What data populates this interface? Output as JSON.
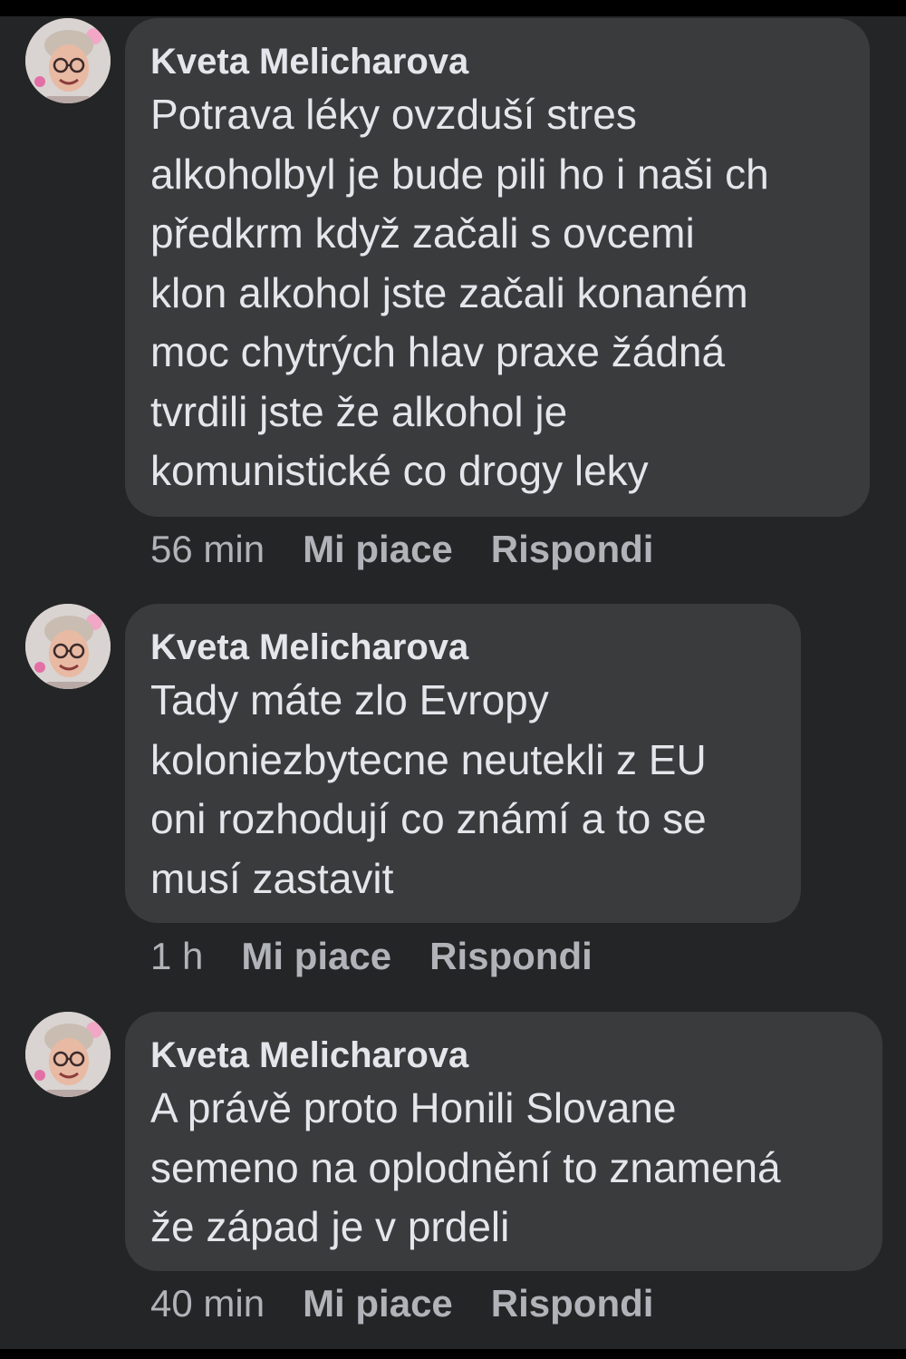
{
  "comments": [
    {
      "author": "Kveta Melicharova",
      "lines": [
        "Potrava léky ovzduší stres",
        "alkoholbyl je bude pili ho i naši ch",
        "předkrm když začali s ovcemi",
        "klon alkohol jste začali konaném",
        "moc chytrých hlav praxe žádná",
        "tvrdili jste že alkohol je",
        "komunistické co drogy leky"
      ],
      "time": "56 min",
      "like_label": "Mi piace",
      "reply_label": "Rispondi"
    },
    {
      "author": "Kveta Melicharova",
      "lines": [
        "Tady máte zlo Evropy",
        "koloniezbytecne neutekli z EU",
        "oni rozhodují co známí a to se",
        "musí zastavit"
      ],
      "time": "1 h",
      "like_label": "Mi piace",
      "reply_label": "Rispondi"
    },
    {
      "author": "Kveta Melicharova",
      "lines": [
        "A právě proto Honili Slovane",
        "semeno na oplodnění to znamená",
        "že západ je v prdeli"
      ],
      "time": "40 min",
      "like_label": "Mi piace",
      "reply_label": "Rispondi"
    }
  ],
  "colors": {
    "background": "#242526",
    "bubble": "#3a3b3c",
    "text": "#e4e6eb",
    "meta": "#b0b3b8"
  }
}
